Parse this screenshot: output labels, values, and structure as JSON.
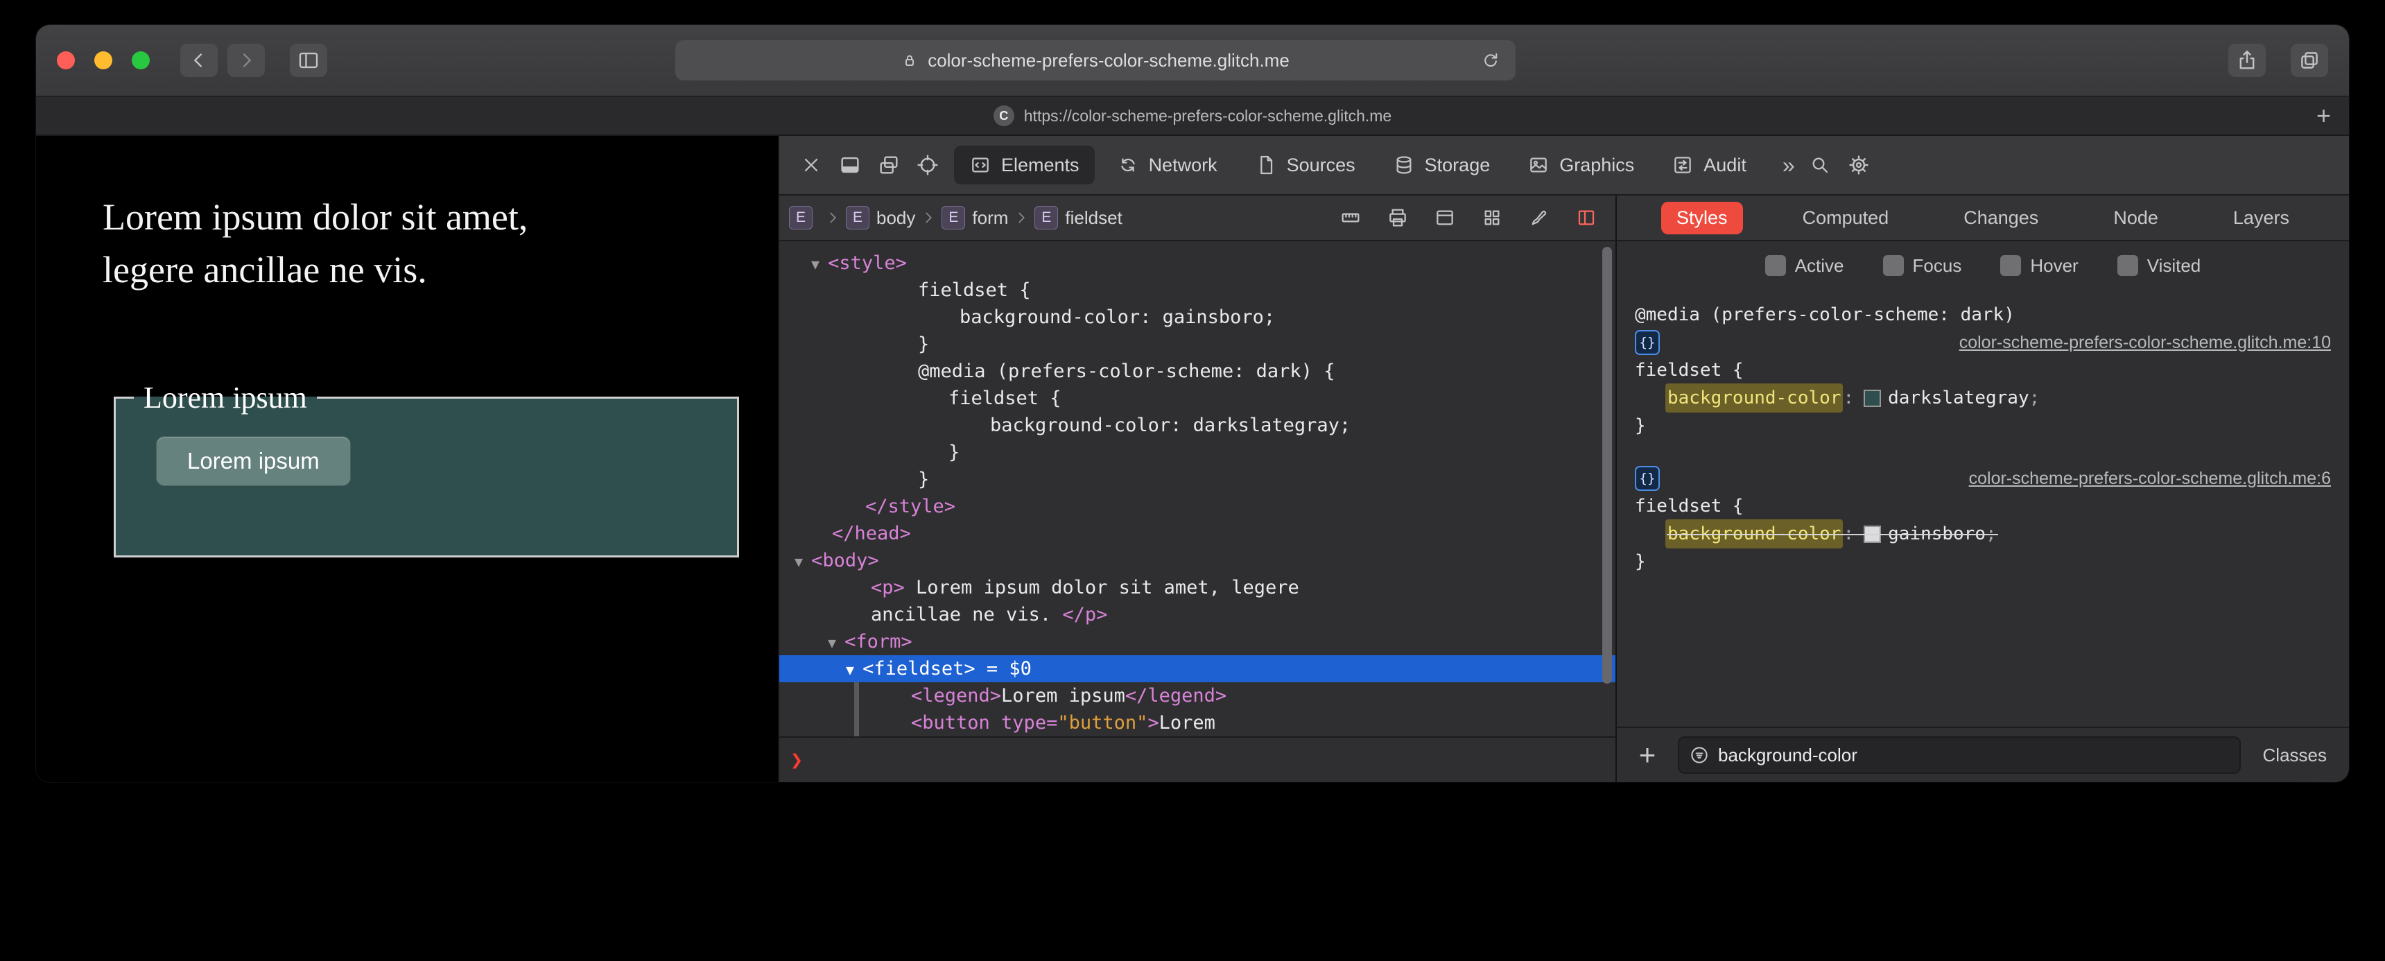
{
  "browser": {
    "url": "color-scheme-prefers-color-scheme.glitch.me",
    "tab_title": "https://color-scheme-prefers-color-scheme.glitch.me",
    "favicon_letter": "C",
    "new_tab_label": "+"
  },
  "page": {
    "paragraph": [
      "Lorem ipsum dolor sit amet,",
      "legere ancillae ne vis."
    ],
    "fieldset_legend": "Lorem ipsum",
    "button_label": "Lorem ipsum",
    "colors": {
      "page_bg": "#000000",
      "fieldset_bg": "#2f4f4f",
      "button_bg": "#66827f"
    }
  },
  "devtools": {
    "toolbar": {
      "tabs": [
        {
          "label": "Elements",
          "active": true
        },
        {
          "label": "Network",
          "active": false
        },
        {
          "label": "Sources",
          "active": false
        },
        {
          "label": "Storage",
          "active": false
        },
        {
          "label": "Graphics",
          "active": false
        },
        {
          "label": "Audit",
          "active": false
        }
      ],
      "overflow": "»"
    },
    "breadcrumb": [
      {
        "badge": "E",
        "label": ""
      },
      {
        "badge": "E",
        "label": "body"
      },
      {
        "badge": "E",
        "label": "form"
      },
      {
        "badge": "E",
        "label": "fieldset"
      }
    ],
    "dom_lines": [
      {
        "indent": 46,
        "tokens": [
          {
            "t": "arw",
            "s": "▼ "
          },
          {
            "t": "tag",
            "s": "<style>"
          }
        ]
      },
      {
        "indent": 200,
        "tokens": [
          {
            "t": "txt",
            "s": "fieldset {"
          }
        ]
      },
      {
        "indent": 260,
        "tokens": [
          {
            "t": "txt",
            "s": "background-color: gainsboro;"
          }
        ]
      },
      {
        "indent": 200,
        "tokens": [
          {
            "t": "txt",
            "s": "}"
          }
        ]
      },
      {
        "indent": 200,
        "tokens": [
          {
            "t": "txt",
            "s": "@media (prefers-color-scheme: dark) {"
          }
        ]
      },
      {
        "indent": 244,
        "tokens": [
          {
            "t": "txt",
            "s": "fieldset {"
          }
        ]
      },
      {
        "indent": 304,
        "tokens": [
          {
            "t": "txt",
            "s": "background-color: darkslategray;"
          }
        ]
      },
      {
        "indent": 244,
        "tokens": [
          {
            "t": "txt",
            "s": "}"
          }
        ]
      },
      {
        "indent": 200,
        "tokens": [
          {
            "t": "txt",
            "s": "}"
          }
        ]
      },
      {
        "indent": 124,
        "tokens": [
          {
            "t": "tag",
            "s": "</style>"
          }
        ]
      },
      {
        "indent": 76,
        "tokens": [
          {
            "t": "tag",
            "s": "</head>"
          }
        ]
      },
      {
        "indent": 22,
        "tokens": [
          {
            "t": "arw",
            "s": "▼ "
          },
          {
            "t": "tag",
            "s": "<body>"
          }
        ]
      },
      {
        "indent": 132,
        "tokens": [
          {
            "t": "tag",
            "s": "<p>"
          },
          {
            "t": "txt",
            "s": " Lorem ipsum dolor sit amet, legere"
          }
        ]
      },
      {
        "indent": 132,
        "tokens": [
          {
            "t": "txt",
            "s": "ancillae ne vis. "
          },
          {
            "t": "tag",
            "s": "</p>"
          }
        ]
      },
      {
        "indent": 70,
        "tokens": [
          {
            "t": "arw",
            "s": "▼ "
          },
          {
            "t": "tag",
            "s": "<form>"
          }
        ]
      },
      {
        "indent": 96,
        "selected": true,
        "tokens": [
          {
            "t": "arw",
            "s": "▼ "
          },
          {
            "t": "tag",
            "s": "<fieldset>"
          },
          {
            "t": "txt",
            "s": " = $0"
          }
        ]
      },
      {
        "indent": 190,
        "gutter": true,
        "tokens": [
          {
            "t": "tag",
            "s": "<legend>"
          },
          {
            "t": "txt",
            "s": "Lorem ipsum"
          },
          {
            "t": "tag",
            "s": "</legend>"
          }
        ]
      },
      {
        "indent": 190,
        "gutter": true,
        "tokens": [
          {
            "t": "tag",
            "s": "<button "
          },
          {
            "t": "attr",
            "s": "type="
          },
          {
            "t": "val",
            "s": "\"button\""
          },
          {
            "t": "tag",
            "s": ">"
          },
          {
            "t": "txt",
            "s": "Lorem"
          }
        ]
      }
    ],
    "console_prompt": "❯",
    "styles_panel": {
      "tabs": [
        {
          "label": "Styles",
          "active": true
        },
        {
          "label": "Computed",
          "active": false
        },
        {
          "label": "Changes",
          "active": false
        },
        {
          "label": "Node",
          "active": false
        },
        {
          "label": "Layers",
          "active": false
        }
      ],
      "pseudo_classes": [
        "Active",
        "Focus",
        "Hover",
        "Visited"
      ],
      "badge_label": "{}",
      "punct": {
        "colon": ":",
        "semicolon": ";",
        "close_brace": "}"
      },
      "rules": [
        {
          "media": "@media (prefers-color-scheme: dark)",
          "source_link": "color-scheme-prefers-color-scheme.glitch.me:10",
          "selector_line": "fieldset {",
          "property": "background-color",
          "value": "darkslategray",
          "swatch": "#2f4f4f",
          "overridden": false
        },
        {
          "source_link": "color-scheme-prefers-color-scheme.glitch.me:6",
          "selector_line": "fieldset {",
          "property": "background-color",
          "value": "gainsboro",
          "swatch": "#dcdcdc",
          "overridden": true
        }
      ],
      "filter": {
        "value": "background-color"
      },
      "classes_label": "Classes",
      "add_rule_label": "+"
    }
  }
}
